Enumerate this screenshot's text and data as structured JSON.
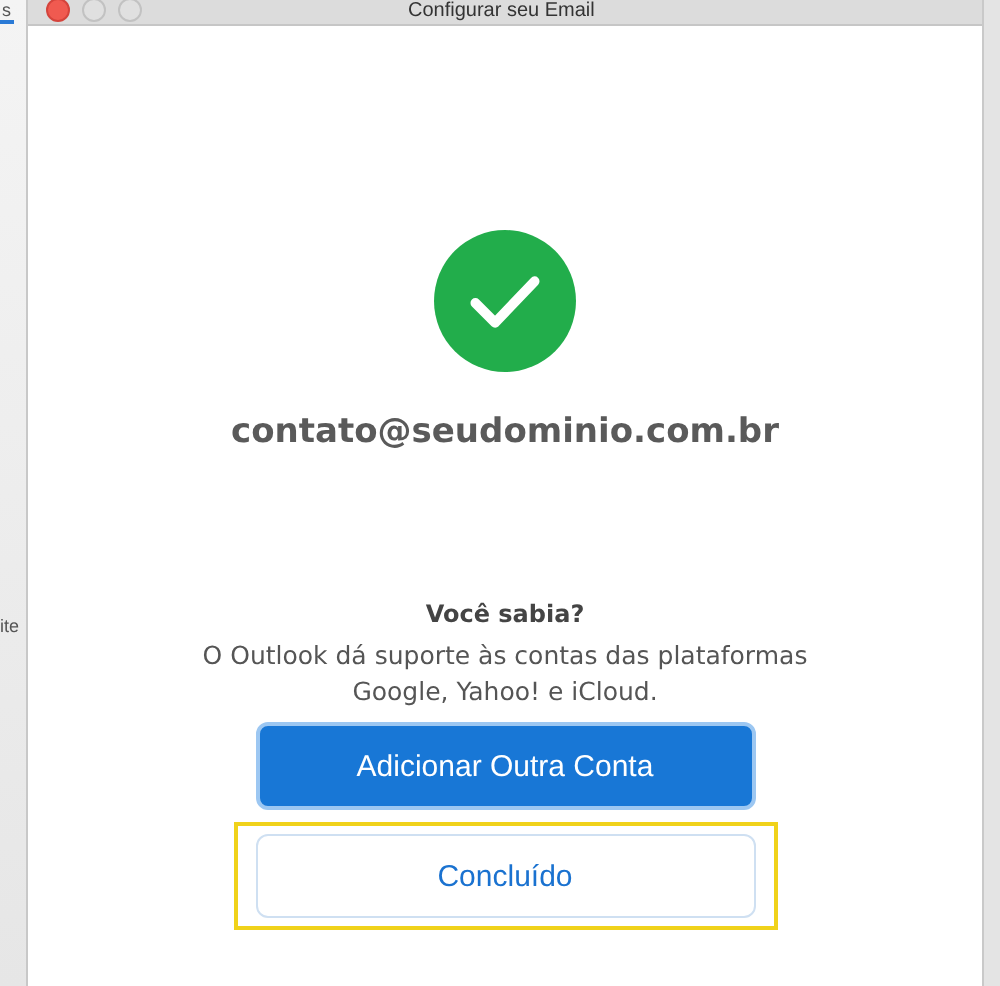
{
  "window": {
    "title": "Configurar seu Email"
  },
  "background_window": {
    "texts": [
      "s",
      "ite"
    ]
  },
  "status": {
    "kind": "success"
  },
  "account": "contato@seudominio.com.br",
  "tip": {
    "heading": "Você sabia?",
    "text": "O Outlook dá suporte às contas das plataformas Google, Yahoo! e iCloud."
  },
  "buttons": [
    {
      "label": "Adicionar Outra Conta",
      "kind": "primary",
      "highlighted": false
    },
    {
      "label": "Concluído",
      "kind": "secondary",
      "highlighted": true
    }
  ]
}
